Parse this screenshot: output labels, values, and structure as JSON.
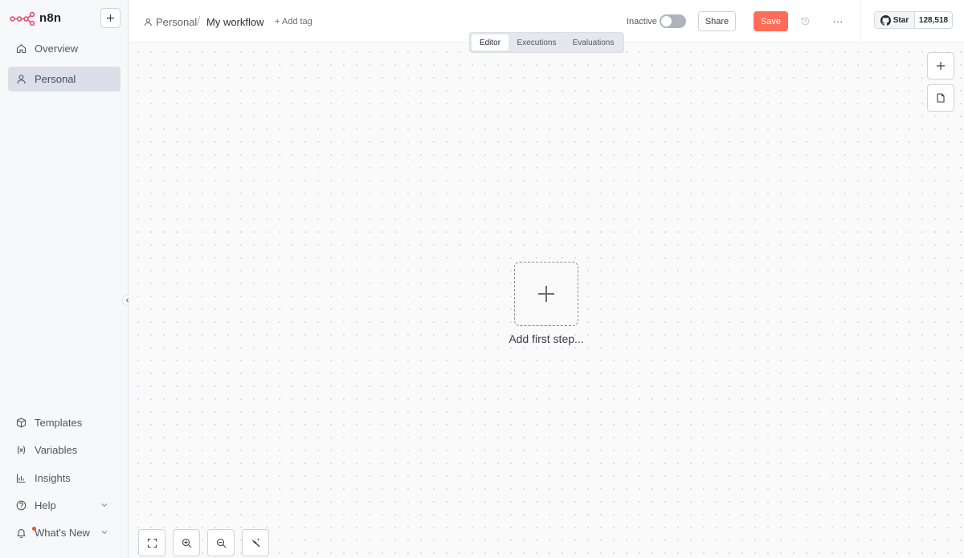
{
  "app": {
    "logo_text": "n8n"
  },
  "sidebar": {
    "items": [
      {
        "label": "Overview",
        "icon": "home-icon"
      },
      {
        "label": "Personal",
        "icon": "user-icon",
        "active": true
      }
    ],
    "bottom_items": [
      {
        "label": "Templates",
        "icon": "box-icon"
      },
      {
        "label": "Variables",
        "icon": "variable-icon"
      },
      {
        "label": "Insights",
        "icon": "chart-icon"
      },
      {
        "label": "Help",
        "icon": "help-circle-icon",
        "has_chevron": true
      },
      {
        "label": "What's New",
        "icon": "bell-icon",
        "has_chevron": true,
        "has_notification": true
      }
    ]
  },
  "header": {
    "project": "Personal",
    "separator": "/",
    "workflow_name": "My workflow",
    "add_tag": "+ Add tag",
    "status_label": "Inactive",
    "share_label": "Share",
    "save_label": "Save",
    "more_label": "···"
  },
  "github": {
    "star_label": "Star",
    "star_count": "128,518"
  },
  "tabs": [
    {
      "label": "Editor",
      "active": true
    },
    {
      "label": "Executions"
    },
    {
      "label": "Evaluations"
    }
  ],
  "canvas": {
    "add_first_step": "Add first step..."
  },
  "colors": {
    "accent": "#ff6d5a",
    "logo": "#ea4b71",
    "active_nav": "#dadfe8"
  }
}
